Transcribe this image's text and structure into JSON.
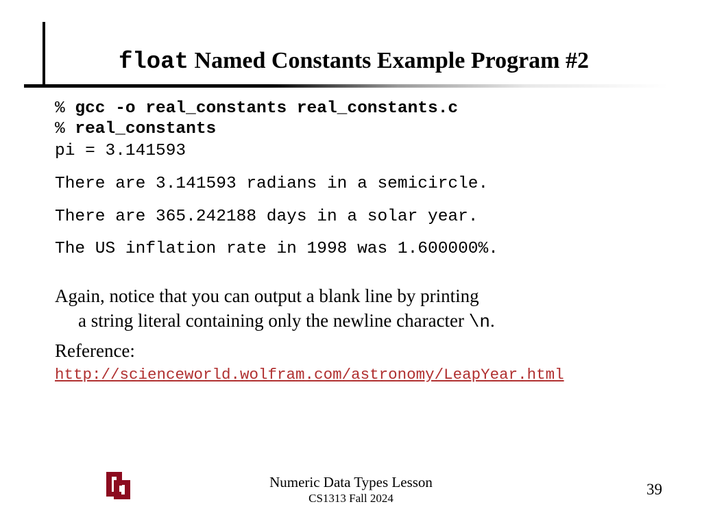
{
  "title": {
    "mono": "float",
    "rest": " Named Constants Example Program #2"
  },
  "code": {
    "prompt1": "% ",
    "cmd1": "gcc -o real_constants real_constants.c",
    "prompt2": "% ",
    "cmd2": "real_constants",
    "out1": "pi = 3.141593",
    "out2": "There are 3.141593 radians in a semicircle.",
    "out3": "There are 365.242188 days in a solar year.",
    "out4": "The US inflation rate in 1998 was 1.600000%."
  },
  "note": {
    "line1": "Again, notice that you can output a blank line by printing",
    "line2a": "a string literal containing only the newline character ",
    "newline_token": "\\n",
    "line2b": "."
  },
  "reference": {
    "label": "Reference:",
    "url": "http://scienceworld.wolfram.com/astronomy/LeapYear.html"
  },
  "footer": {
    "title": "Numeric Data Types Lesson",
    "subtitle": "CS1313 Fall 2024",
    "page": "39"
  },
  "colors": {
    "link": "#b03030",
    "logo": "#8c0b1f"
  }
}
